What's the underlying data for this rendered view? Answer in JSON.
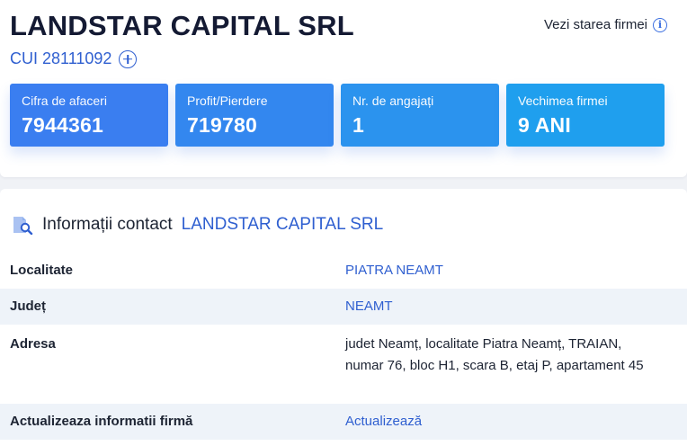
{
  "header": {
    "company_name": "LANDSTAR CAPITAL SRL",
    "cui": "CUI 28111092",
    "status_link": "Vezi starea firmei"
  },
  "stats": [
    {
      "label": "Cifra de afaceri",
      "value": "7944361",
      "color": "#3a7ef0"
    },
    {
      "label": "Profit/Pierdere",
      "value": "719780",
      "color": "#3387ef"
    },
    {
      "label": "Nr. de angajați",
      "value": "1",
      "color": "#2b93ee"
    },
    {
      "label": "Vechimea firmei",
      "value": "9 ANI",
      "color": "#1f9fee"
    }
  ],
  "contact": {
    "title_prefix": "Informații contact",
    "title_company": "LANDSTAR CAPITAL SRL",
    "rows": [
      {
        "key": "Localitate",
        "value": "PIATRA NEAMT"
      },
      {
        "key": "Județ",
        "value": "NEAMT"
      },
      {
        "key": "Adresa",
        "value": "judet Neamț, localitate Piatra Neamț, TRAIAN, numar 76, bloc H1, scara B, etaj P, apartament 45"
      },
      {
        "key": "Actualizeaza informatii firmă",
        "value": "Actualizează"
      }
    ]
  },
  "colors": {
    "accent": "#2f5fd0",
    "row_alt": "#eef3f9",
    "page_bg": "#f0f2f6"
  },
  "icons": {
    "add": "plus-circle-icon",
    "info": "info-icon",
    "contact": "document-search-icon"
  }
}
